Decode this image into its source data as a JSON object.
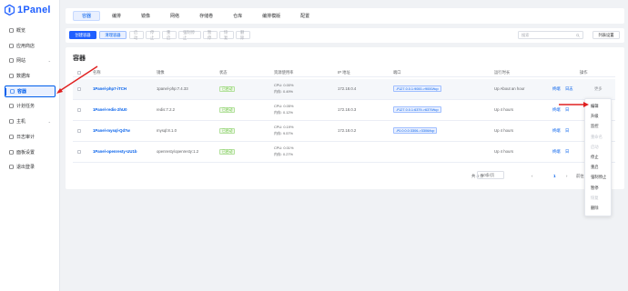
{
  "app": {
    "brand": "1Panel"
  },
  "sidebar": {
    "items": [
      {
        "label": "概览",
        "icon": "home-icon",
        "chevron": false,
        "active": false
      },
      {
        "label": "应用商店",
        "icon": "store-icon",
        "chevron": false,
        "active": false
      },
      {
        "label": "网站",
        "icon": "globe-icon",
        "chevron": true,
        "active": false
      },
      {
        "label": "数据库",
        "icon": "database-icon",
        "chevron": false,
        "active": false
      },
      {
        "label": "容器",
        "icon": "container-icon",
        "chevron": false,
        "active": true
      },
      {
        "label": "计划任务",
        "icon": "calendar-icon",
        "chevron": false,
        "active": false
      },
      {
        "label": "主机",
        "icon": "host-icon",
        "chevron": true,
        "active": false
      },
      {
        "label": "日志审计",
        "icon": "log-icon",
        "chevron": false,
        "active": false
      },
      {
        "label": "面板设置",
        "icon": "settings-icon",
        "chevron": false,
        "active": false
      },
      {
        "label": "退出登录",
        "icon": "logout-icon",
        "chevron": false,
        "active": false
      }
    ]
  },
  "tabs": [
    "容器",
    "编排",
    "镜像",
    "网络",
    "存储卷",
    "仓库",
    "编排模版",
    "配置"
  ],
  "toolbar": {
    "create": "创建容器",
    "clean": "清理容器",
    "start": "启动",
    "stop": "停止",
    "restart": "重启",
    "kill": "强制停止",
    "pause": "暂停",
    "unpause": "恢复",
    "delete": "删除",
    "search_placeholder": "搜索",
    "column_settings": "列表设置"
  },
  "panel": {
    "title": "容器"
  },
  "table": {
    "headers": {
      "name": "名称",
      "image": "镜像",
      "status": "状态",
      "resources": "资源使用率",
      "ip": "IP 地址",
      "ports": "端口",
      "uptime": "运行时长",
      "actions": "操作"
    },
    "rows": [
      {
        "name": "1Panel-php7-iTCH",
        "image": "1panel-php:7.4.33",
        "status": "已启动",
        "cpu": "CPU: 0.00%",
        "mem": "内存: 0.49%",
        "ip": "172.18.0.4",
        "port": "127.0.0.1:9000->9000/tcp",
        "uptime": "Up About an hour",
        "actions": [
          "终端",
          "日志",
          "更多"
        ]
      },
      {
        "name": "1Panel-redis-2hU0",
        "image": "redis:7.2.2",
        "status": "已启动",
        "cpu": "CPU: 0.05%",
        "mem": "内存: 0.12%",
        "ip": "172.18.0.3",
        "port": "127.0.0.1:6379->6379/tcp",
        "uptime": "Up 4 hours",
        "actions": [
          "终端",
          "日"
        ]
      },
      {
        "name": "1Panel-mysql-Qd7w",
        "image": "mysql:8.1.0",
        "status": "已启动",
        "cpu": "CPU: 0.19%",
        "mem": "内存: 9.57%",
        "ip": "172.18.0.2",
        "port": "0.0.0.0:3306->3306/tcp",
        "uptime": "Up 4 hours",
        "actions": [
          "终端",
          "日"
        ]
      },
      {
        "name": "1Panel-openresty-UU1b",
        "image": "openresty/openresty:1.2",
        "status": "已启动",
        "cpu": "CPU: 0.01%",
        "mem": "内存: 0.27%",
        "ip": "",
        "port": "",
        "uptime": "Up 4 hours",
        "actions": [
          "终端",
          "日"
        ]
      }
    ]
  },
  "pagination": {
    "total": "共 4 条",
    "page_size": "10条/页",
    "current_page": "1",
    "goto": "前往"
  },
  "dropdown": {
    "items": [
      {
        "label": "编辑",
        "disabled": false
      },
      {
        "label": "升级",
        "disabled": false
      },
      {
        "label": "监控",
        "disabled": false
      },
      {
        "label": "重命名",
        "disabled": true
      },
      {
        "label": "启动",
        "disabled": true
      },
      {
        "label": "停止",
        "disabled": false
      },
      {
        "label": "重启",
        "disabled": false
      },
      {
        "label": "强制停止",
        "disabled": false
      },
      {
        "label": "暂停",
        "disabled": false
      },
      {
        "label": "恢复",
        "disabled": true
      },
      {
        "label": "删除",
        "disabled": false
      }
    ]
  },
  "colors": {
    "accent": "#005eeb",
    "primary_button": "#1f5fff",
    "running": "#67c23a",
    "annotation_arrow": "#e02020"
  }
}
